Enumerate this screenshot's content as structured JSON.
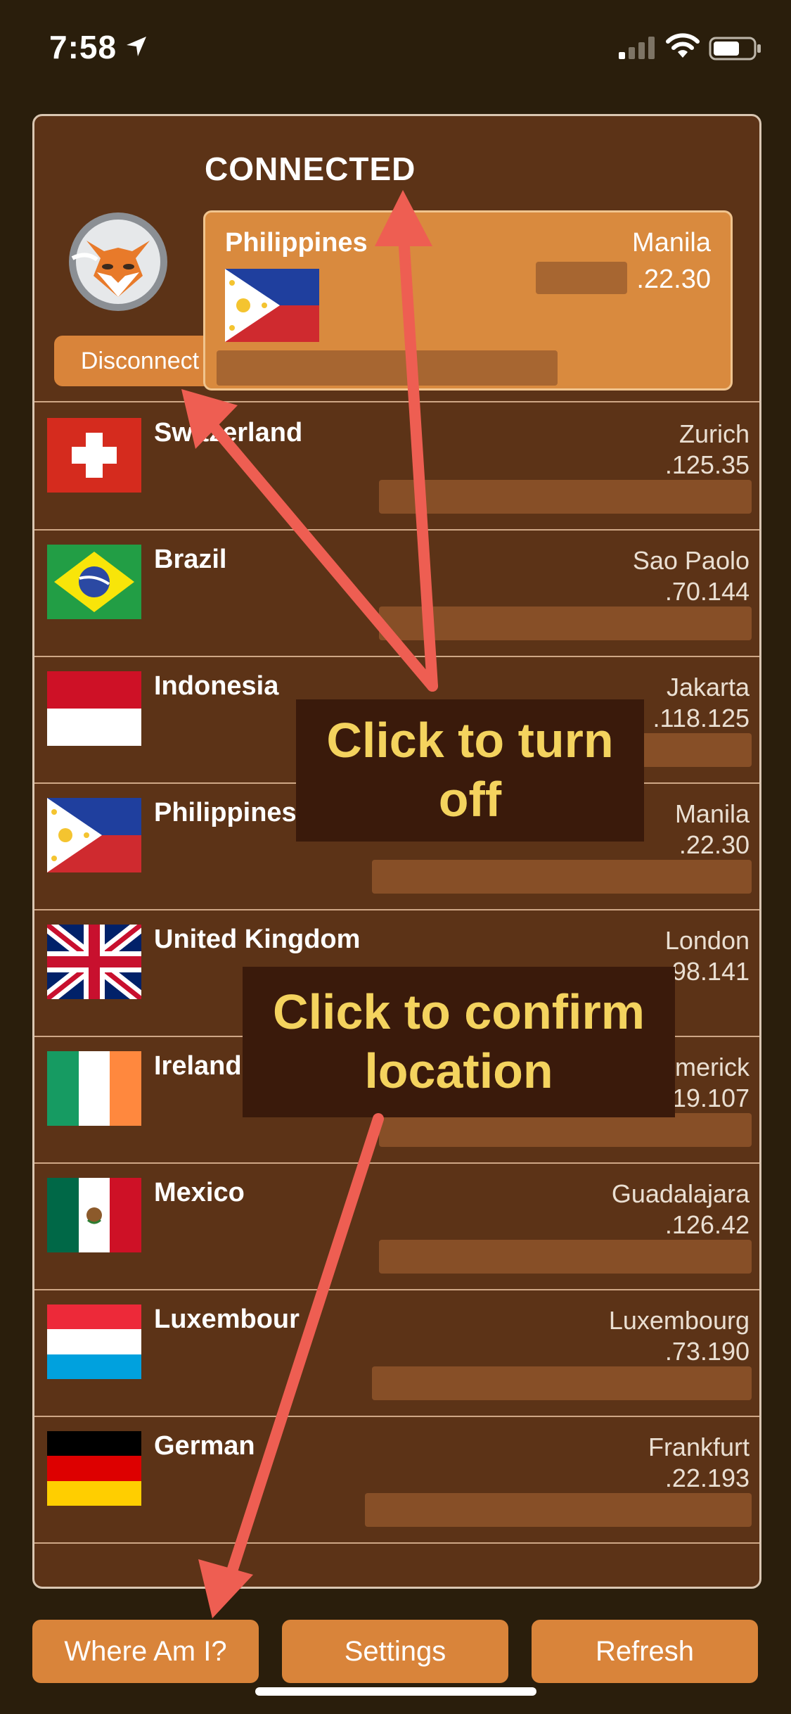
{
  "status": {
    "time": "7:58"
  },
  "connection": {
    "title": "CONNECTED",
    "disconnect_label": "Disconnect",
    "current": {
      "country": "Philippines",
      "city": "Manila",
      "ip": ".22.30",
      "flag": "philippines-flag"
    }
  },
  "servers": [
    {
      "country": "Switzerland",
      "city": "Zurich",
      "ip": ".125.35",
      "flag": "switzerland-flag"
    },
    {
      "country": "Brazil",
      "city": "Sao Paolo",
      "ip": ".70.144",
      "flag": "brazil-flag"
    },
    {
      "country": "Indonesia",
      "city": "Jakarta",
      "ip": ".118.125",
      "flag": "indonesia-flag"
    },
    {
      "country": "Philippines",
      "city": "Manila",
      "ip": ".22.30",
      "flag": "philippines-flag"
    },
    {
      "country": "United Kingdom",
      "city": "London",
      "ip": "98.141",
      "flag": "uk-flag"
    },
    {
      "country": "Ireland",
      "city": "merick",
      "ip": "19.107",
      "flag": "ireland-flag"
    },
    {
      "country": "Mexico",
      "city": "Guadalajara",
      "ip": ".126.42",
      "flag": "mexico-flag"
    },
    {
      "country": "Luxembour",
      "city": "Luxembourg",
      "ip": ".73.190",
      "flag": "luxembourg-flag"
    },
    {
      "country": "German",
      "city": "Frankfurt",
      "ip": ".22.193",
      "flag": "germany-flag"
    }
  ],
  "buttons": {
    "where_am_i": "Where Am I?",
    "settings": "Settings",
    "refresh": "Refresh"
  },
  "callouts": {
    "turn_off": "Click to turn off",
    "confirm": "Click to confirm location"
  },
  "colors": {
    "accent": "#d9843a",
    "panel": "#5c3317",
    "callout_text": "#f4d35e",
    "arrow": "#ee5e52"
  }
}
